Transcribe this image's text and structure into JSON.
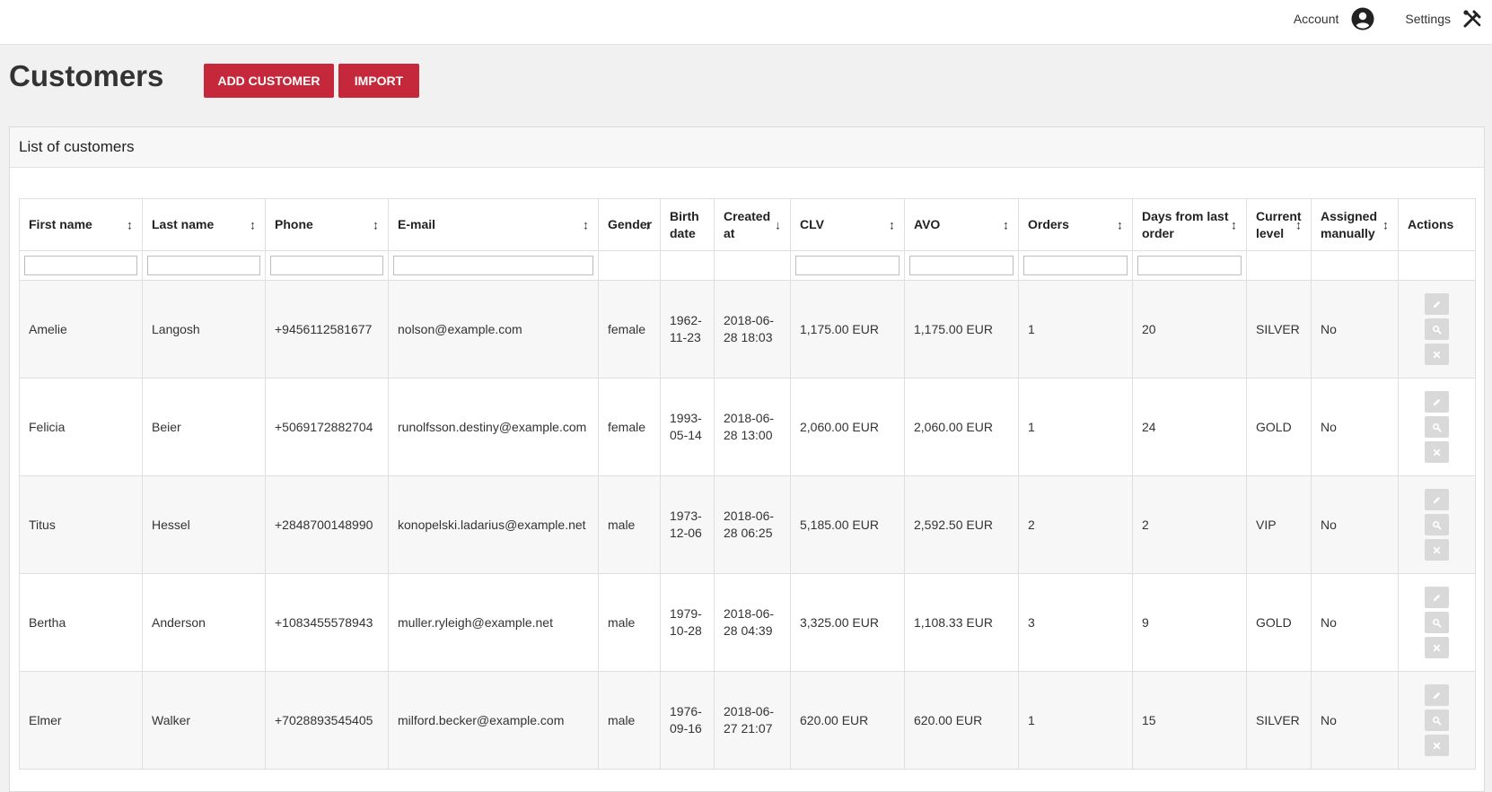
{
  "topnav": {
    "account_label": "Account",
    "settings_label": "Settings",
    "account_icon": "user-circle-icon",
    "settings_icon": "tools-icon"
  },
  "page": {
    "title": "Customers",
    "add_label": "ADD CUSTOMER",
    "import_label": "IMPORT"
  },
  "panel": {
    "title": "List of customers"
  },
  "colors": {
    "accent": "#c4283a",
    "action_bg": "#d9d9d9"
  },
  "columns": [
    {
      "label": "First name",
      "sort": "↕"
    },
    {
      "label": "Last name",
      "sort": "↕"
    },
    {
      "label": "Phone",
      "sort": "↕"
    },
    {
      "label": "E-mail",
      "sort": "↕"
    },
    {
      "label": "Gender",
      "sort": "↕"
    },
    {
      "label": "Birth date",
      "sort": ""
    },
    {
      "label": "Created at",
      "sort": "↓"
    },
    {
      "label": "CLV",
      "sort": "↕"
    },
    {
      "label": "AVO",
      "sort": "↕"
    },
    {
      "label": "Orders",
      "sort": "↕"
    },
    {
      "label": "Days from last order",
      "sort": "↕"
    },
    {
      "label": "Current level",
      "sort": "↕"
    },
    {
      "label": "Assigned manually",
      "sort": "↕"
    },
    {
      "label": "Actions",
      "sort": ""
    }
  ],
  "rows": [
    [
      "Amelie",
      "Langosh",
      "+9456112581677",
      "nolson@example.com",
      "female",
      "1962-11-23",
      "2018-06-28 18:03",
      "1,175.00  EUR",
      "1,175.00  EUR",
      "1",
      "20",
      "SILVER",
      "No"
    ],
    [
      "Felicia",
      "Beier",
      "+5069172882704",
      "runolfsson.destiny@example.com",
      "female",
      "1993-05-14",
      "2018-06-28 13:00",
      "2,060.00  EUR",
      "2,060.00  EUR",
      "1",
      "24",
      "GOLD",
      "No"
    ],
    [
      "Titus",
      "Hessel",
      "+2848700148990",
      "konopelski.ladarius@example.net",
      "male",
      "1973-12-06",
      "2018-06-28 06:25",
      "5,185.00  EUR",
      "2,592.50  EUR",
      "2",
      "2",
      "VIP",
      "No"
    ],
    [
      "Bertha",
      "Anderson",
      "+1083455578943",
      "muller.ryleigh@example.net",
      "male",
      "1979-10-28",
      "2018-06-28 04:39",
      "3,325.00  EUR",
      "1,108.33  EUR",
      "3",
      "9",
      "GOLD",
      "No"
    ],
    [
      "Elmer",
      "Walker",
      "+7028893545405",
      "milford.becker@example.com",
      "male",
      "1976-09-16",
      "2018-06-27 21:07",
      "620.00  EUR",
      "620.00  EUR",
      "1",
      "15",
      "SILVER",
      "No"
    ]
  ],
  "row_actions": [
    "edit-icon",
    "view-icon",
    "delete-icon"
  ]
}
